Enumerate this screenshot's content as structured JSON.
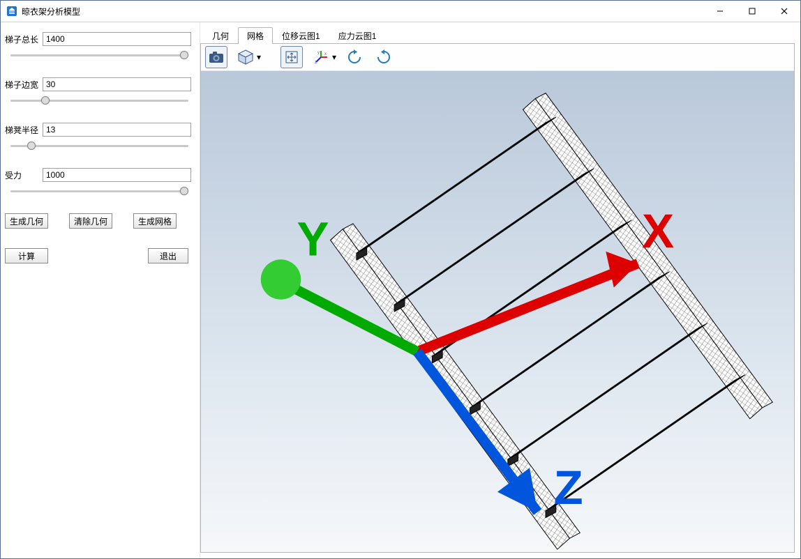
{
  "window": {
    "title": "晾衣架分析模型",
    "controls": {
      "min": "–",
      "max": "□",
      "close": "✕"
    }
  },
  "params": {
    "total_length": {
      "label": "梯子总长",
      "value": "1400",
      "slider": 100
    },
    "side_width": {
      "label": "梯子边宽",
      "value": "30",
      "slider": 18
    },
    "rung_radius": {
      "label": "梯凳半径",
      "value": "13",
      "slider": 10
    },
    "force": {
      "label": "受力",
      "value": "1000",
      "slider": 100
    }
  },
  "buttons": {
    "gen_geom": "生成几何",
    "clear_geom": "清除几何",
    "gen_mesh": "生成网格",
    "compute": "计算",
    "exit": "退出"
  },
  "tabs": {
    "geometry": "几何",
    "mesh": "网格",
    "disp": "位移云图1",
    "stress": "应力云图1",
    "active": "mesh"
  },
  "toolbar": {
    "snapshot": "snapshot",
    "view_cube": "view-cube",
    "fit": "fit-view",
    "axes": "axes-triad",
    "rotate_ccw": "rotate-ccw",
    "rotate_cw": "rotate-cw"
  },
  "triad": {
    "x": "X",
    "y": "Y",
    "z": "Z"
  }
}
